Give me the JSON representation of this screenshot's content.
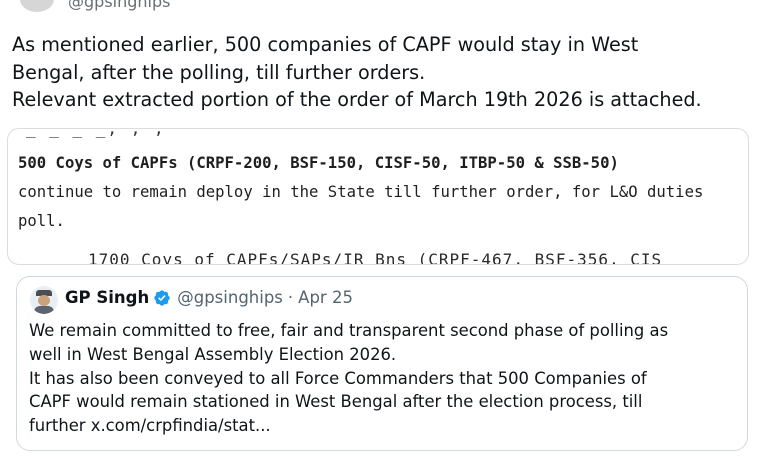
{
  "top": {
    "handle": "@gpsinghips"
  },
  "tweet": {
    "lines": [
      "As mentioned earlier, 500 companies of CAPF would stay in West",
      "Bengal, after the polling, till further orders.",
      "Relevant extracted portion of the order of March 19th 2026 is attached."
    ]
  },
  "attachment": {
    "cut_top": "_ _ _ _, ,                                   ,",
    "lines": [
      "500 Coys of CAPFs (CRPF-200, BSF-150, CISF-50, ITBP-50 & SSB-50)",
      "continue to remain deploy in the State till further order, for L&O duties",
      "poll."
    ],
    "cut_bottom": "1700 Coys of CAPFs/SAPs/IR Bns (CRPF-467, BSF-356, CIS"
  },
  "quote": {
    "name": "GP Singh",
    "handle": "@gpsinghips",
    "separator": "·",
    "date": "Apr 25",
    "lines": [
      "We remain committed to free, fair and transparent second phase of polling as",
      "well in West Bengal Assembly Election 2026.",
      "It has also been conveyed to all Force Commanders that 500 Companies of",
      "CAPF would remain stationed in West Bengal after the election process, till",
      "further x.com/crpfindia/stat..."
    ],
    "verified_color": "#1d9bf0"
  }
}
